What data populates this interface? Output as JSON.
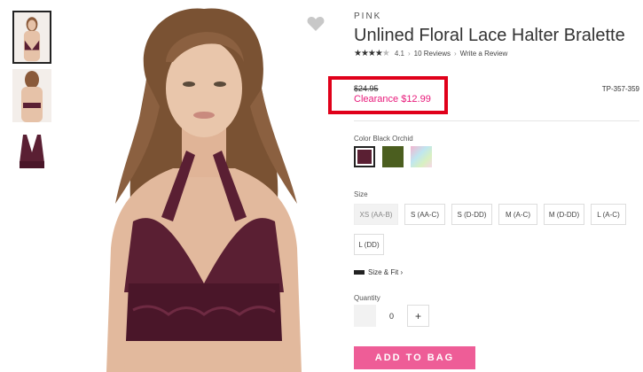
{
  "product": {
    "brand": "PINK",
    "title": "Unlined Floral Lace Halter Bralette",
    "rating_value": "4.1",
    "reviews_label": "10 Reviews",
    "write_review_label": "Write a Review",
    "original_price": "$24.95",
    "clearance_price": "Clearance $12.99",
    "sku": "TP-357-359"
  },
  "color": {
    "label": "Color Black Orchid",
    "swatches": [
      {
        "name": "Black Orchid",
        "hex": "#5a1f33"
      },
      {
        "name": "Olive",
        "hex": "#4b5e1f"
      },
      {
        "name": "Tie-dye",
        "hex": "#c9e6d5"
      }
    ]
  },
  "size": {
    "label": "Size",
    "options": [
      "XS (AA-B)",
      "S (AA-C)",
      "S (D-DD)",
      "M (A-C)",
      "M (D-DD)",
      "L (A-C)",
      "L (DD)"
    ]
  },
  "size_fit_label": "Size & Fit ›",
  "quantity": {
    "label": "Quantity",
    "value": "0",
    "plus_label": "+"
  },
  "add_to_bag_label": "ADD TO BAG",
  "colors": {
    "accent_pink": "#ee5d97",
    "clearance_pink": "#e8197a",
    "highlight_red": "#e0001a"
  }
}
